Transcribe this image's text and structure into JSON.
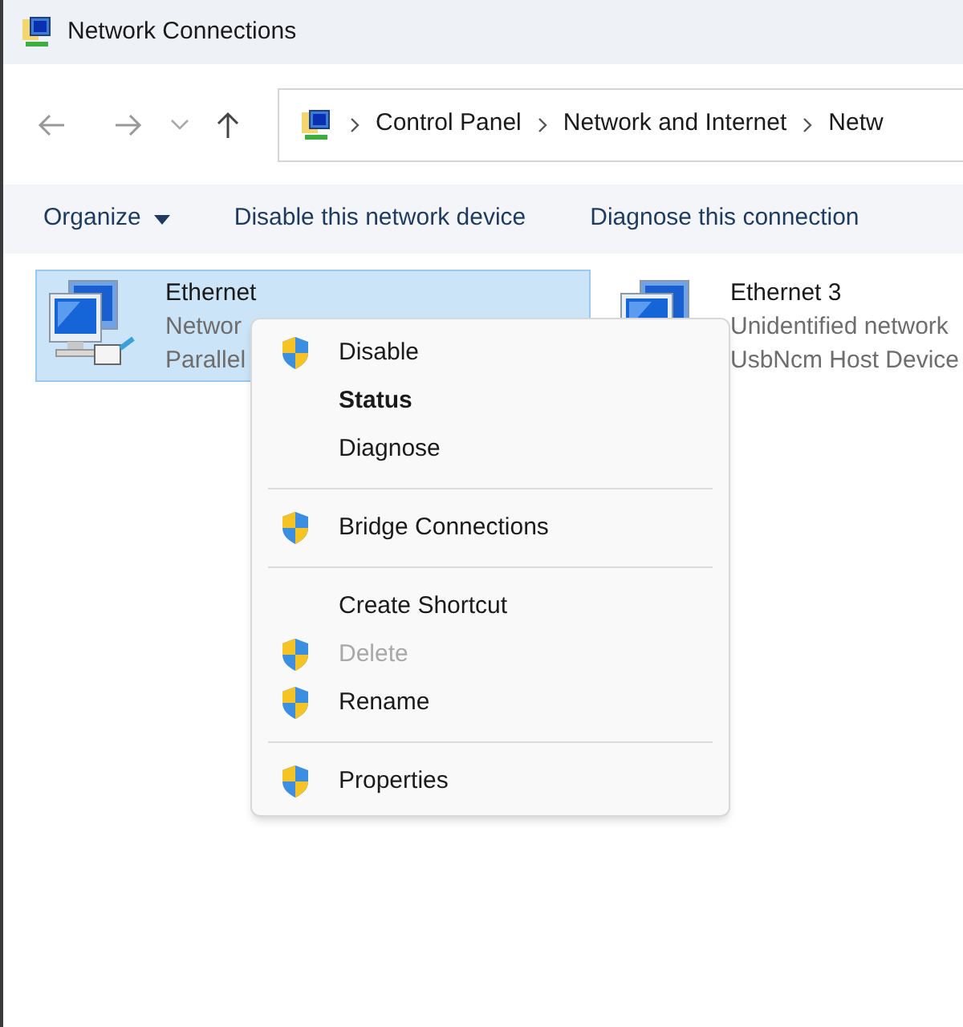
{
  "window": {
    "title": "Network Connections"
  },
  "breadcrumb": [
    "Control Panel",
    "Network and Internet",
    "Netw"
  ],
  "commands": [
    {
      "label": "Organize",
      "dropdown": true
    },
    {
      "label": "Disable this network device",
      "dropdown": false
    },
    {
      "label": "Diagnose this connection",
      "dropdown": false
    }
  ],
  "connections": [
    {
      "name": "Ethernet",
      "status": "Networ",
      "device": "Parallel",
      "selected": true
    },
    {
      "name": "Ethernet 3",
      "status": "Unidentified network",
      "device": "UsbNcm Host Device",
      "selected": false
    }
  ],
  "context_menu": [
    {
      "kind": "item",
      "label": "Disable",
      "shield": true,
      "default": false,
      "disabled": false
    },
    {
      "kind": "item",
      "label": "Status",
      "shield": false,
      "default": true,
      "disabled": false
    },
    {
      "kind": "item",
      "label": "Diagnose",
      "shield": false,
      "default": false,
      "disabled": false
    },
    {
      "kind": "separator"
    },
    {
      "kind": "item",
      "label": "Bridge Connections",
      "shield": true,
      "default": false,
      "disabled": false
    },
    {
      "kind": "separator"
    },
    {
      "kind": "item",
      "label": "Create Shortcut",
      "shield": false,
      "default": false,
      "disabled": false
    },
    {
      "kind": "item",
      "label": "Delete",
      "shield": true,
      "default": false,
      "disabled": true
    },
    {
      "kind": "item",
      "label": "Rename",
      "shield": true,
      "default": false,
      "disabled": false
    },
    {
      "kind": "separator"
    },
    {
      "kind": "item",
      "label": "Properties",
      "shield": true,
      "default": false,
      "disabled": false
    }
  ]
}
